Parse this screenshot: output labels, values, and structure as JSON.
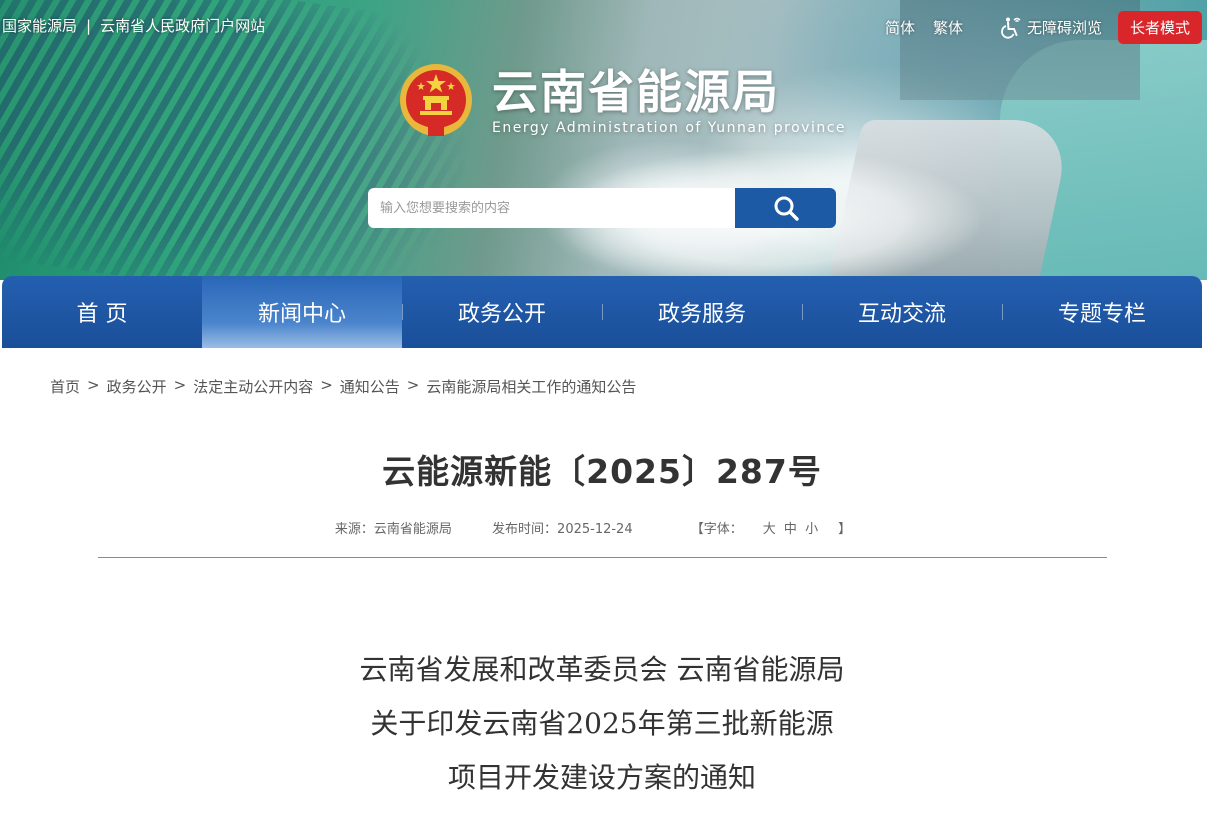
{
  "header": {
    "top_links": [
      "国家能源局",
      "云南省人民政府门户网站"
    ],
    "separator": "|",
    "lang_simplified": "简体",
    "lang_traditional": "繁体",
    "accessibility": "无障碍浏览",
    "elder_mode": "长者模式",
    "site_name_cn": "云南省能源局",
    "site_name_en": "Energy Administration of Yunnan province"
  },
  "search": {
    "placeholder": "输入您想要搜索的内容"
  },
  "nav": {
    "items": [
      {
        "label": "首 页"
      },
      {
        "label": "新闻中心"
      },
      {
        "label": "政务公开"
      },
      {
        "label": "政务服务"
      },
      {
        "label": "互动交流"
      },
      {
        "label": "专题专栏"
      }
    ],
    "active_index": 1
  },
  "breadcrumb": {
    "items": [
      "首页",
      "政务公开",
      "法定主动公开内容",
      "通知公告",
      "云南能源局相关工作的通知公告"
    ],
    "separator": ">"
  },
  "article": {
    "title": "云能源新能〔2025〕287号",
    "source": "来源：云南省能源局",
    "publish_time": "发布时间：2025-12-24",
    "font_size_prefix": "【字体：",
    "font_large": "大",
    "font_medium": "中",
    "font_small": "小",
    "font_size_suffix": "】",
    "heading_lines": [
      "云南省发展和改革委员会 云南省能源局",
      "关于印发云南省2025年第三批新能源",
      "项目开发建设方案的通知"
    ]
  },
  "colors": {
    "nav_blue": "#1d5aa6",
    "elder_red": "#d8262b",
    "title_text": "#333333"
  }
}
